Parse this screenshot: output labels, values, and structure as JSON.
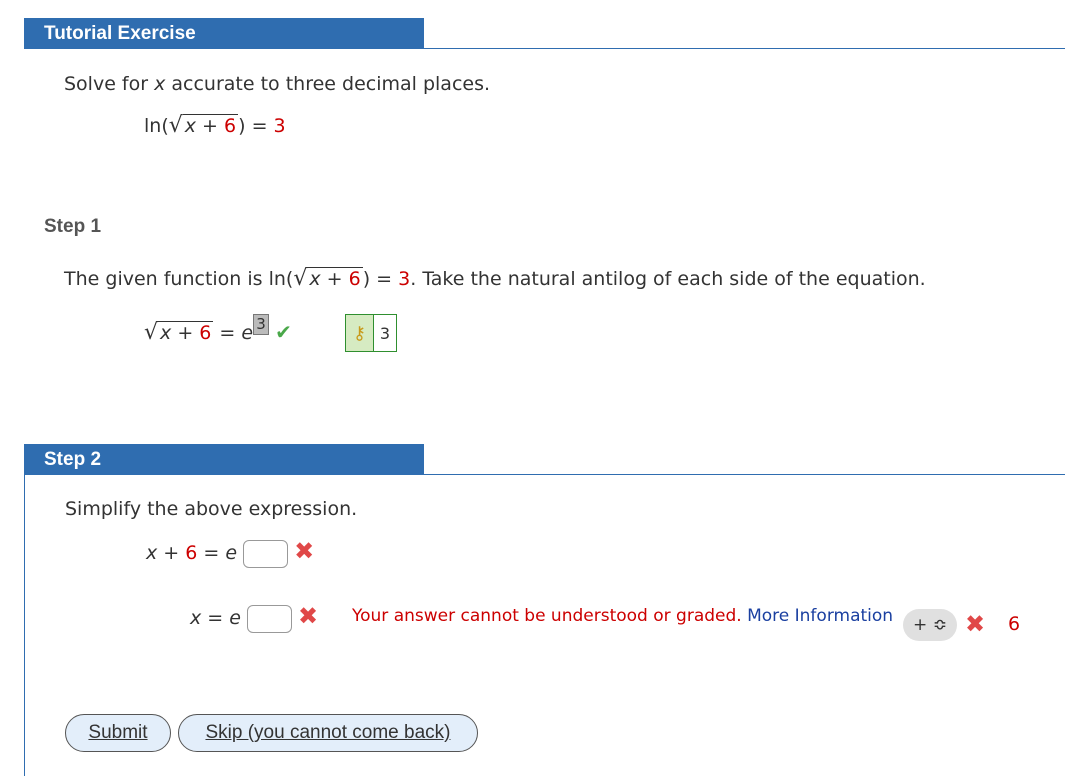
{
  "header": {
    "title": "Tutorial Exercise"
  },
  "problem": {
    "prompt_start": "Solve for ",
    "prompt_var": "x",
    "prompt_end": " accurate to three decimal places.",
    "eq_ln": "ln(",
    "eq_x": "x",
    "eq_plus": " + ",
    "eq_6": "6",
    "eq_close": ")",
    "eq_equals": " = ",
    "eq_rhs": "3"
  },
  "step1": {
    "label": "Step 1",
    "text_start": "The given function is ln(",
    "x": "x",
    "plus": " + ",
    "six": "6",
    "close": ")",
    "equals": " = ",
    "rhs": "3",
    "text_end": ". Take the natural antilog of each side of the equation.",
    "eq_x": "x",
    "eq_plus": " + ",
    "eq_6": "6",
    "eq_equals": " = ",
    "eq_e": "e",
    "exponent_answer": "3",
    "key_value": "3",
    "check_icon": "check-icon",
    "key_icon": "key-icon"
  },
  "step2": {
    "header": "Step 2",
    "instruction": "Simplify the above expression.",
    "eq1_x": "x",
    "eq1_plus": " + ",
    "eq1_6": "6",
    "eq1_equals": " = ",
    "eq1_e": "e",
    "eq2_x": "x",
    "eq2_equals": " = ",
    "eq2_e": "e",
    "error_text": "Your answer cannot be understood or graded. ",
    "more_info": "More Information",
    "stepper": "+ ≎",
    "trailing_value": "6",
    "submit": "Submit",
    "skip": "Skip (you cannot come back)"
  },
  "colors": {
    "header_blue": "#2f6db0",
    "red": "#cc0000",
    "link": "#1a3fa0"
  }
}
